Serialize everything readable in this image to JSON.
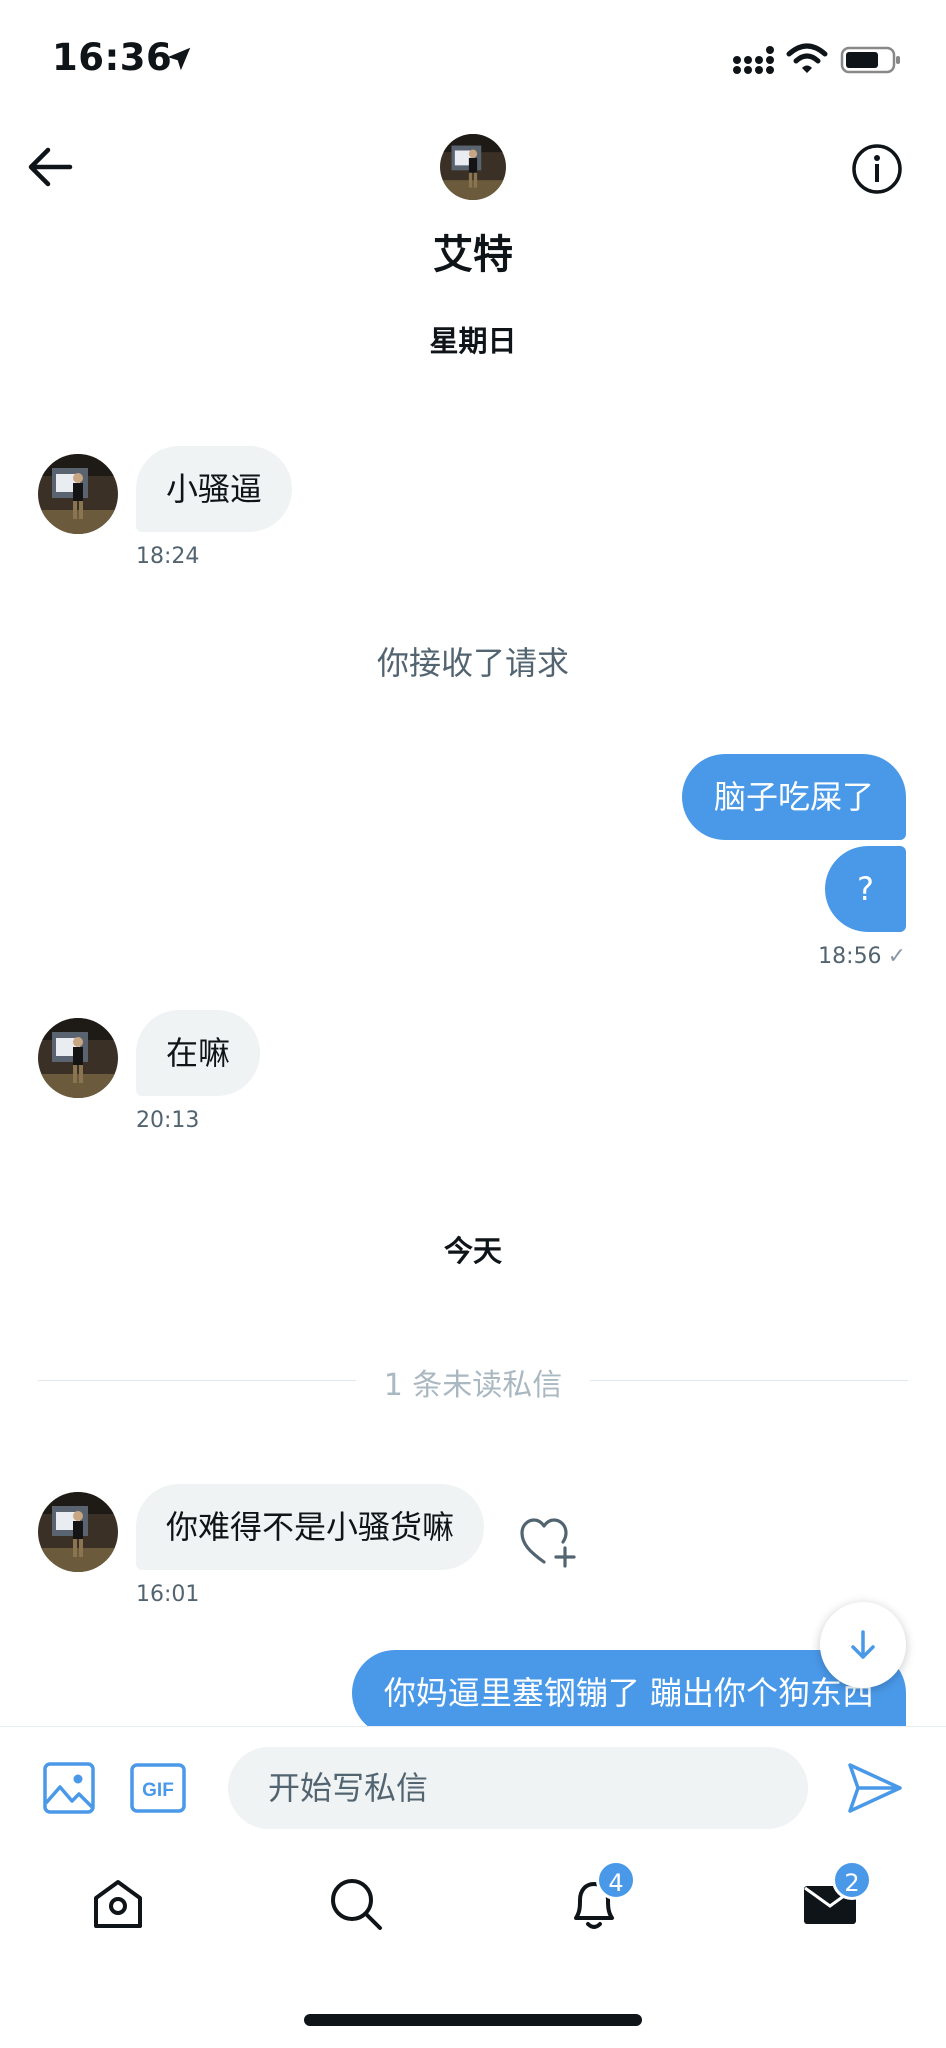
{
  "status_bar": {
    "time": "16:36"
  },
  "header": {
    "name": "艾特"
  },
  "dates": {
    "sunday": "星期日",
    "today": "今天"
  },
  "messages": [
    {
      "text": "小骚逼",
      "time": "18:24"
    },
    {
      "system": "你接收了请求"
    },
    {
      "text": "脑子吃屎了"
    },
    {
      "text": "?",
      "time": "18:56",
      "check": "✓"
    },
    {
      "text": "在嘛",
      "time": "20:13"
    },
    {
      "text": "你难得不是小骚货嘛",
      "time": "16:01"
    },
    {
      "text": "你妈逼里塞钢镚了 蹦出你个狗东西"
    }
  ],
  "unread_divider": "1 条未读私信",
  "composer": {
    "placeholder": "开始写私信",
    "gif_label": "GIF"
  },
  "tabs": {
    "notifications_badge": "4",
    "messages_badge": "2"
  },
  "colors": {
    "accent": "#4a99e9",
    "bubble_in": "#eff3f4",
    "muted": "#536471"
  }
}
